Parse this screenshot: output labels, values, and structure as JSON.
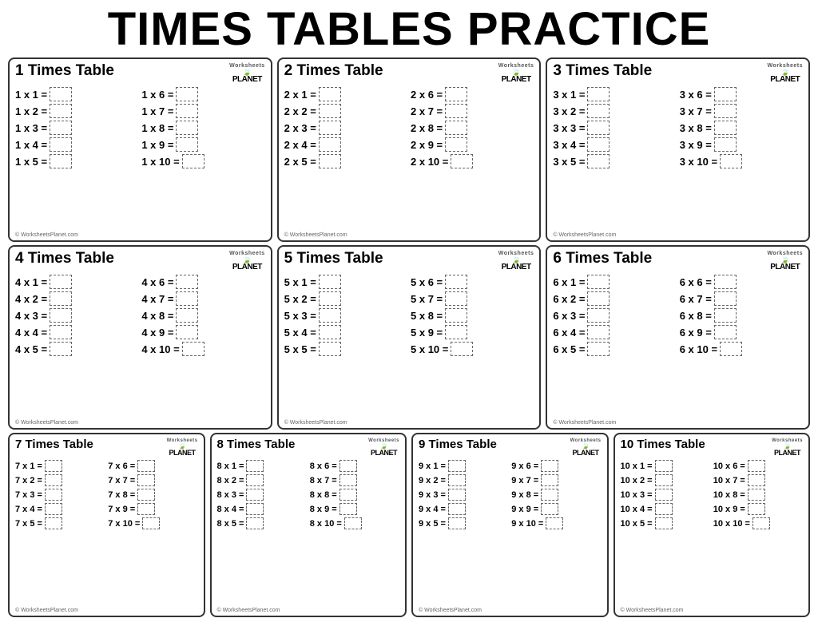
{
  "title": "TIMES TABLES PRACTICE",
  "cards": [
    {
      "id": "tt1",
      "title": "1 Times Table",
      "col1": [
        "1 x 1 =",
        "1 x 2 =",
        "1 x 3 =",
        "1 x 4 =",
        "1 x 5 ="
      ],
      "col2": [
        "1 x 6 =",
        "1 x 7 =",
        "1 x 8 =",
        "1 x 9 =",
        "1 x 10 ="
      ]
    },
    {
      "id": "tt2",
      "title": "2 Times Table",
      "col1": [
        "2 x 1 =",
        "2 x 2 =",
        "2 x 3 =",
        "2 x 4 =",
        "2 x 5 ="
      ],
      "col2": [
        "2 x 6 =",
        "2 x 7 =",
        "2 x 8 =",
        "2 x 9 =",
        "2 x 10 ="
      ]
    },
    {
      "id": "tt3",
      "title": "3 Times Table",
      "col1": [
        "3 x 1 =",
        "3 x 2 =",
        "3 x 3 =",
        "3 x 4 =",
        "3 x 5 ="
      ],
      "col2": [
        "3 x 6 =",
        "3 x 7 =",
        "3 x 8 =",
        "3 x 9 =",
        "3 x 10 ="
      ]
    },
    {
      "id": "tt4",
      "title": "4 Times Table",
      "col1": [
        "4 x 1 =",
        "4 x 2 =",
        "4 x 3 =",
        "4 x 4 =",
        "4 x 5 ="
      ],
      "col2": [
        "4 x 6 =",
        "4 x 7 =",
        "4 x 8 =",
        "4 x 9 =",
        "4 x 10 ="
      ]
    },
    {
      "id": "tt5",
      "title": "5 Times Table",
      "col1": [
        "5 x 1 =",
        "5 x 2 =",
        "5 x 3 =",
        "5 x 4 =",
        "5 x 5 ="
      ],
      "col2": [
        "5 x 6 =",
        "5 x 7 =",
        "5 x 8 =",
        "5 x 9 =",
        "5 x 10 ="
      ]
    },
    {
      "id": "tt6",
      "title": "6 Times Table",
      "col1": [
        "6 x 1 =",
        "6 x 2 =",
        "6 x 3 =",
        "6 x 4 =",
        "6 x 5 ="
      ],
      "col2": [
        "6 x 6 =",
        "6 x 7 =",
        "6 x 8 =",
        "6 x 9 =",
        "6 x 10 ="
      ]
    },
    {
      "id": "tt7",
      "title": "7 Times Table",
      "col1": [
        "7 x 1 =",
        "7 x 2 =",
        "7 x 3 =",
        "7 x 4 =",
        "7 x 5 ="
      ],
      "col2": [
        "7 x 6 =",
        "7 x 7 =",
        "7 x 8 =",
        "7 x 9 =",
        "7 x 10 ="
      ]
    },
    {
      "id": "tt8",
      "title": "8 Times Table",
      "col1": [
        "8 x 1 =",
        "8 x 2 =",
        "8 x 3 =",
        "8 x 4 =",
        "8 x 5 ="
      ],
      "col2": [
        "8 x 6 =",
        "8 x 7 =",
        "8 x 8 =",
        "8 x 9 =",
        "8 x 10 ="
      ]
    },
    {
      "id": "tt9",
      "title": "9 Times Table",
      "col1": [
        "9 x 1 =",
        "9 x 2 =",
        "9 x 3 =",
        "9 x 4 =",
        "9 x 5 ="
      ],
      "col2": [
        "9 x 6 =",
        "9 x 7 =",
        "9 x 8 =",
        "9 x 9 =",
        "9 x 10 ="
      ]
    },
    {
      "id": "tt10",
      "title": "10 Times Table",
      "col1": [
        "10 x 1 =",
        "10 x 2 =",
        "10 x 3 =",
        "10 x 4 =",
        "10 x 5 ="
      ],
      "col2": [
        "10 x 6 =",
        "10 x 7 =",
        "10 x 8 =",
        "10 x 9 =",
        "10 x 10 ="
      ]
    }
  ],
  "footer": "© WorksheetsPlanet.com"
}
